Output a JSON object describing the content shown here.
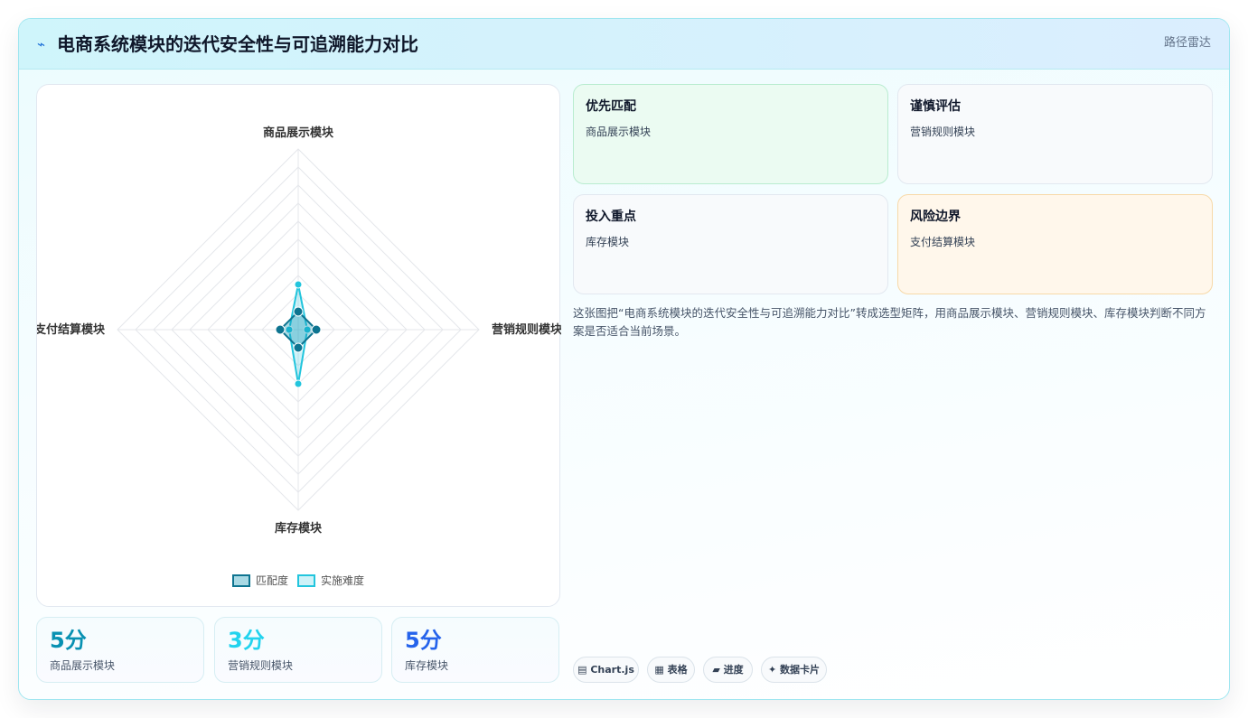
{
  "header": {
    "icon": "line-chart-icon",
    "title": "电商系统模块的迭代安全性与可追溯能力对比",
    "tag": "路径雷达"
  },
  "chart_data": {
    "type": "radar",
    "categories": [
      "商品展示模块",
      "营销规则模块",
      "库存模块",
      "支付结算模块"
    ],
    "rmax": 20,
    "grid_levels": 10,
    "series": [
      {
        "name": "匹配度",
        "values": [
          2,
          2,
          2,
          2
        ],
        "color": "#0e7490",
        "fill": "rgba(8,145,178,0.35)"
      },
      {
        "name": "实施难度",
        "values": [
          5,
          1,
          6,
          1
        ],
        "color": "#22c5dd",
        "fill": "rgba(34,197,221,0.22)"
      }
    ],
    "legend_position": "bottom"
  },
  "stats": [
    {
      "value": "5分",
      "label": "商品展示模块",
      "color": "#0891b2"
    },
    {
      "value": "3分",
      "label": "营销规则模块",
      "color": "#22d3ee"
    },
    {
      "value": "5分",
      "label": "库存模块",
      "color": "#2563eb"
    }
  ],
  "tiles": [
    {
      "title": "优先匹配",
      "subtitle": "商品展示模块"
    },
    {
      "title": "谨慎评估",
      "subtitle": "营销规则模块"
    },
    {
      "title": "投入重点",
      "subtitle": "库存模块"
    },
    {
      "title": "风险边界",
      "subtitle": "支付结算模块"
    }
  ],
  "description": "这张图把“电商系统模块的迭代安全性与可追溯能力对比”转成选型矩阵，用商品展示模块、营销规则模块、库存模块判断不同方案是否适合当前场景。",
  "chips": [
    {
      "icon": "chart-icon",
      "glyph": "▤",
      "label": "Chart.js"
    },
    {
      "icon": "table-icon",
      "glyph": "▦",
      "label": "表格"
    },
    {
      "icon": "progress-icon",
      "glyph": "▰",
      "label": "进度"
    },
    {
      "icon": "card-icon",
      "glyph": "✦",
      "label": "数据卡片"
    }
  ]
}
